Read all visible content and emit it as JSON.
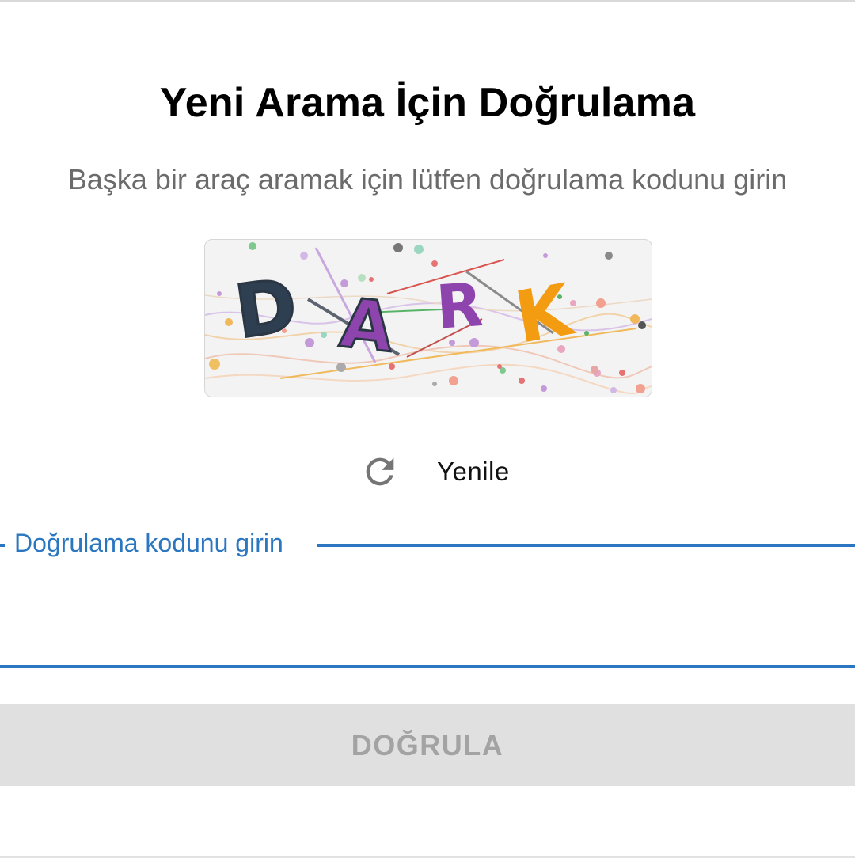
{
  "dialog": {
    "title": "Yeni Arama İçin Doğrulama",
    "subtitle": "Başka bir araç aramak için lütfen doğrulama kodunu girin"
  },
  "captcha": {
    "text": "DARK",
    "letters": [
      {
        "char": "D",
        "color": "#2f3f52"
      },
      {
        "char": "A",
        "color": "#8e44ad"
      },
      {
        "char": "R",
        "color": "#8e44ad"
      },
      {
        "char": "K",
        "color": "#f39c12"
      }
    ],
    "background_color": "#f3f3f3"
  },
  "refresh": {
    "icon": "refresh-icon",
    "label": "Yenile"
  },
  "code_field": {
    "label": "Doğrulama kodunu girin",
    "value": "",
    "accent_color": "#2a76c0"
  },
  "verify_button": {
    "label": "DOĞRULA",
    "enabled": false
  }
}
